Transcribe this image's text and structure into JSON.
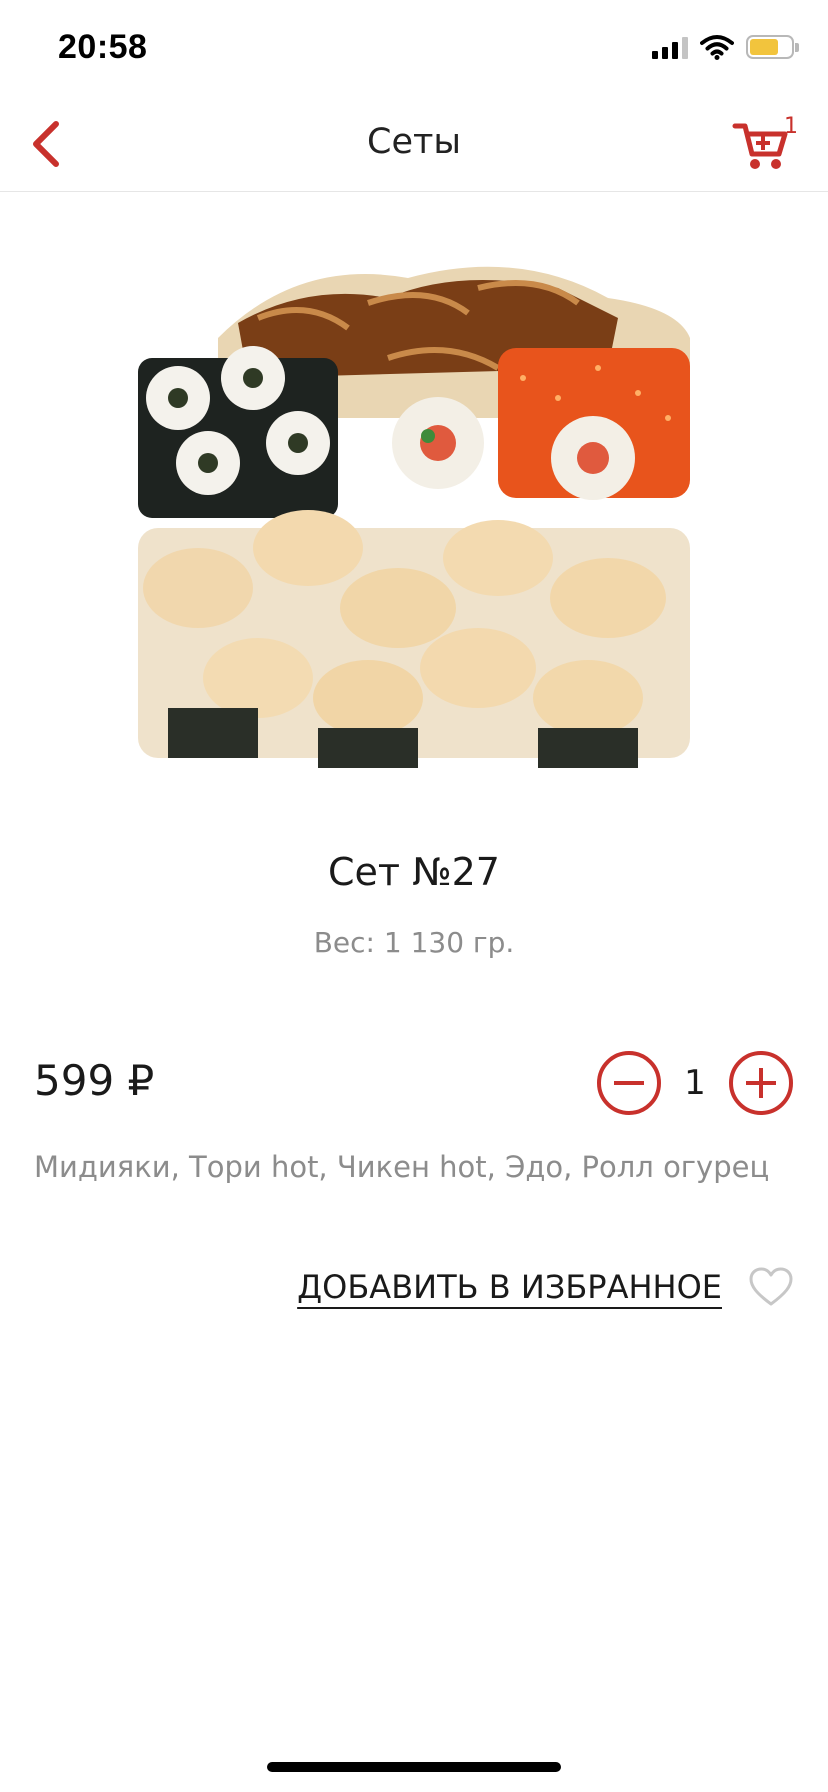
{
  "status_bar": {
    "time": "20:58",
    "icons": [
      "cellular-signal-icon",
      "wifi-icon",
      "battery-icon"
    ],
    "battery_level": 0.7
  },
  "nav": {
    "title": "Сеты",
    "back_icon": "chevron-left-icon",
    "cart_icon": "cart-icon",
    "cart_count": "1"
  },
  "product": {
    "image": "sushi-set-photo",
    "name": "Сет №27",
    "weight": "Вес: 1 130 гр.",
    "price": "599 ₽",
    "quantity": "1",
    "ingredients": "Мидияки, Тори hot, Чикен hot, Эдо, Ролл огурец"
  },
  "favorites": {
    "label": "ДОБАВИТЬ В ИЗБРАННОЕ",
    "icon": "heart-icon"
  },
  "colors": {
    "accent": "#c8312c",
    "text": "#1a1a1a",
    "muted": "#8c8c8c",
    "battery": "#f2c43d"
  }
}
